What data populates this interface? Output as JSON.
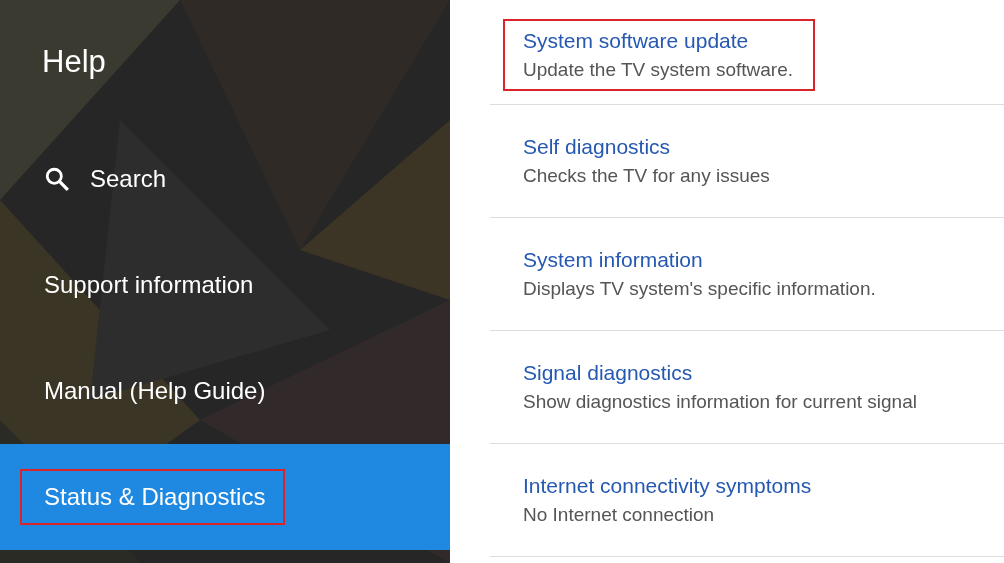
{
  "sidebar": {
    "title": "Help",
    "items": [
      {
        "label": "Search",
        "kind": "search",
        "selected": false,
        "highlighted": false
      },
      {
        "label": "Support information",
        "kind": "plain",
        "selected": false,
        "highlighted": false
      },
      {
        "label": "Manual (Help Guide)",
        "kind": "plain",
        "selected": false,
        "highlighted": false
      },
      {
        "label": "Status & Diagnostics",
        "kind": "plain",
        "selected": true,
        "highlighted": true
      }
    ]
  },
  "options": [
    {
      "title": "System software update",
      "description": "Update the TV system software.",
      "highlighted": true
    },
    {
      "title": "Self diagnostics",
      "description": "Checks the TV for any issues",
      "highlighted": false
    },
    {
      "title": "System information",
      "description": "Displays TV system's specific information.",
      "highlighted": false
    },
    {
      "title": "Signal diagnostics",
      "description": "Show diagnostics information for current signal",
      "highlighted": false
    },
    {
      "title": "Internet connectivity symptoms",
      "description": "No Internet connection",
      "highlighted": false
    }
  ]
}
